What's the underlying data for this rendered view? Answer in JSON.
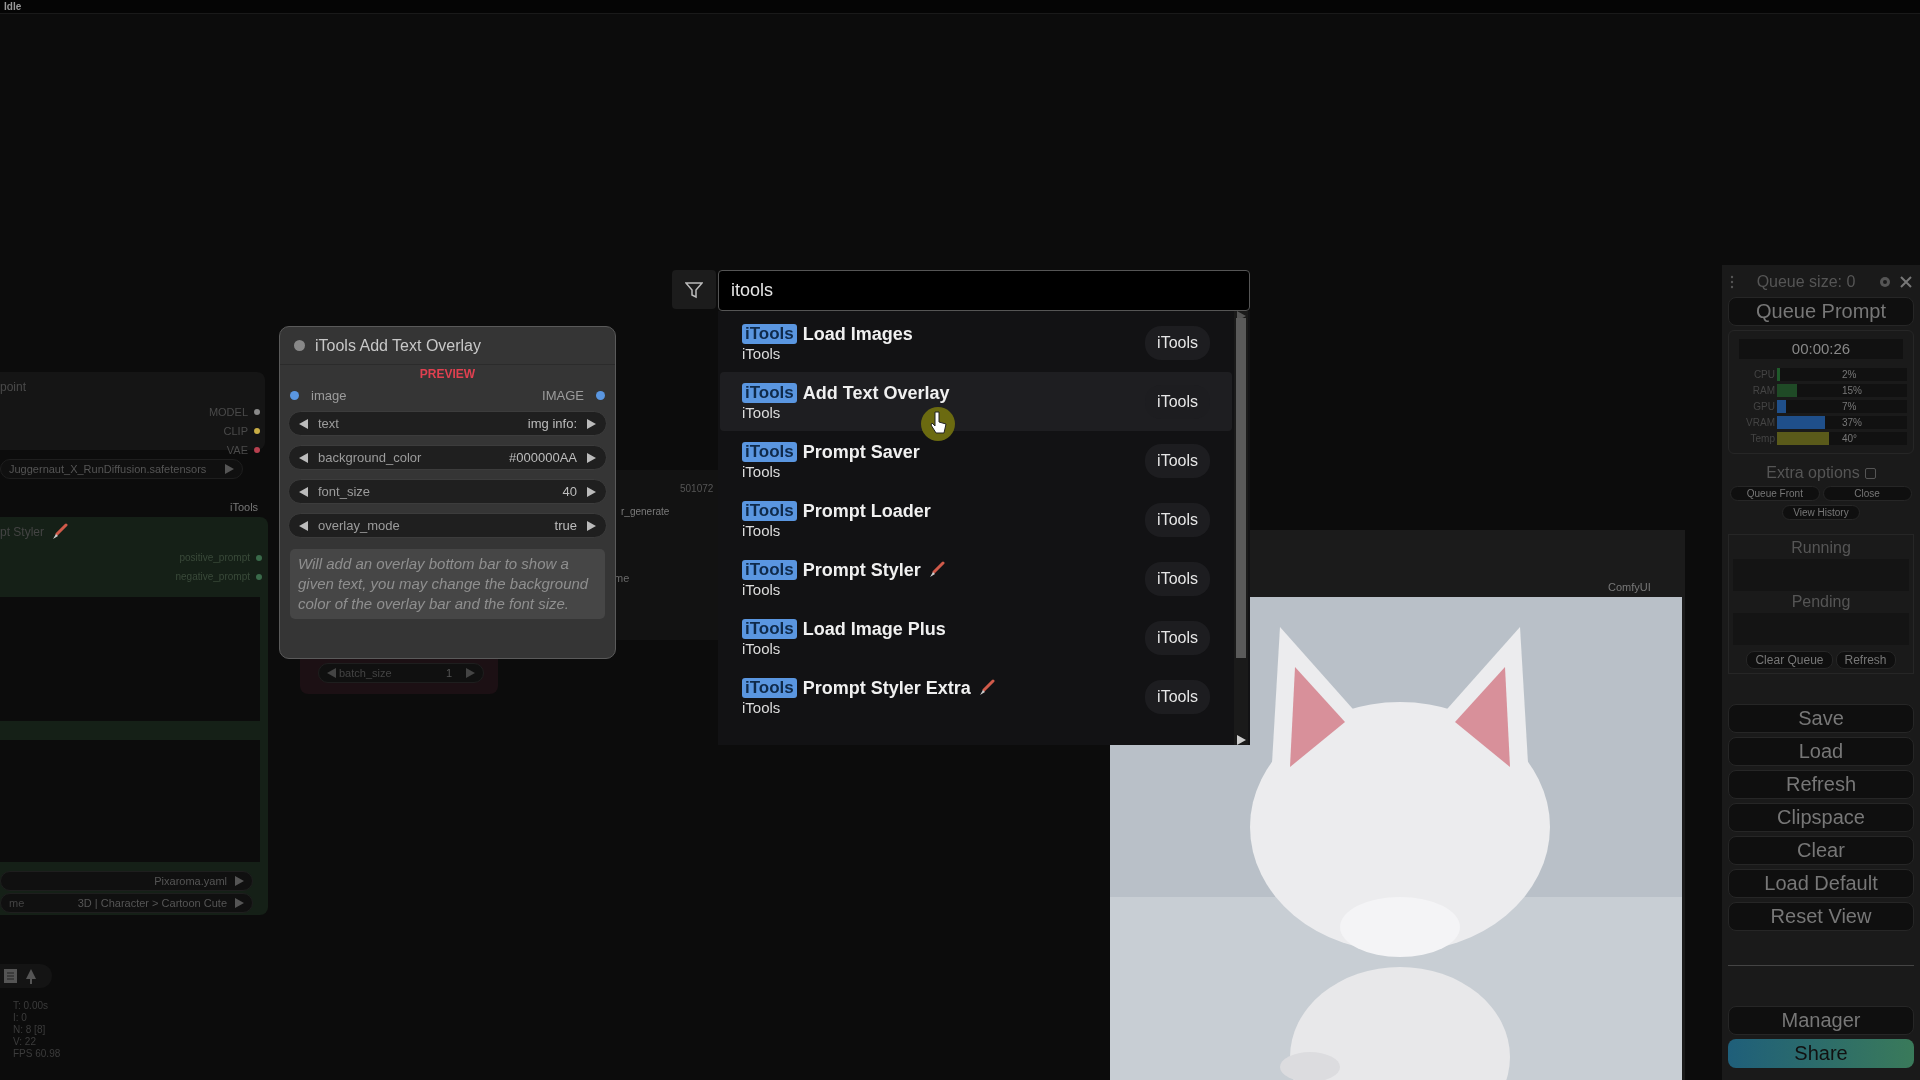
{
  "status": "Idle",
  "checkpoint_node": {
    "title": "point",
    "outputs": [
      {
        "label": "MODEL",
        "color": "#8a8a8a"
      },
      {
        "label": "CLIP",
        "color": "#c9ad45"
      },
      {
        "label": "VAE",
        "color": "#b8404f"
      }
    ],
    "combo": "Juggernaut_X_RunDiffusion.safetensors"
  },
  "group_label": "iTools",
  "styler_node": {
    "title": "pt Styler",
    "outputs": [
      "positive_prompt",
      "negative_prompt"
    ],
    "combos": [
      {
        "value": "Pixaroma.yaml"
      },
      {
        "label": "me",
        "value": "3D | Character > Cartoon Cute"
      }
    ]
  },
  "overlay_node": {
    "title": "iTools Add Text Overlay",
    "badge": "PREVIEW",
    "input": "image",
    "output": "IMAGE",
    "widgets": [
      {
        "name": "text",
        "value": "img info:"
      },
      {
        "name": "background_color",
        "value": "#000000AA"
      },
      {
        "name": "font_size",
        "value": "40"
      },
      {
        "name": "overlay_mode",
        "value": "true"
      }
    ],
    "description": "Will add an overlay bottom bar to show a given text, you may change the background color of the overlay bar and the font size."
  },
  "hidden_node_texts": [
    "501072",
    "r_generate",
    "me"
  ],
  "latent_node": {
    "name": "batch_size",
    "value": "1"
  },
  "search": {
    "value": "itools",
    "results": [
      {
        "tag": "iTools",
        "name": "Load Images",
        "category": "iTools",
        "source": "iTools",
        "selected": false,
        "brush": false
      },
      {
        "tag": "iTools",
        "name": "Add Text Overlay",
        "category": "iTools",
        "source": "iTools",
        "selected": true,
        "brush": false
      },
      {
        "tag": "iTools",
        "name": "Prompt Saver",
        "category": "iTools",
        "source": "iTools",
        "selected": false,
        "brush": false
      },
      {
        "tag": "iTools",
        "name": "Prompt Loader",
        "category": "iTools",
        "source": "iTools",
        "selected": false,
        "brush": false
      },
      {
        "tag": "iTools",
        "name": "Prompt Styler",
        "category": "iTools",
        "source": "iTools",
        "selected": false,
        "brush": true
      },
      {
        "tag": "iTools",
        "name": "Load Image Plus",
        "category": "iTools",
        "source": "iTools",
        "selected": false,
        "brush": false
      },
      {
        "tag": "iTools",
        "name": "Prompt Styler Extra",
        "category": "iTools",
        "source": "iTools",
        "selected": false,
        "brush": true
      }
    ]
  },
  "preview_node": {
    "badge": "ComfyUI"
  },
  "queue_panel": {
    "queue_size": "Queue size: 0",
    "queue_button": "Queue Prompt",
    "timer": "00:00:26",
    "monitors": [
      {
        "label": "CPU",
        "reading": "2%",
        "level": 0.02,
        "color": "#1f5a2a"
      },
      {
        "label": "RAM",
        "reading": "15%",
        "level": 0.15,
        "color": "#1f4a26"
      },
      {
        "label": "GPU",
        "reading": "7%",
        "level": 0.07,
        "color": "#1f4f8a"
      },
      {
        "label": "VRAM",
        "reading": "37%",
        "level": 0.37,
        "color": "#1f4f8a"
      },
      {
        "label": "Temp",
        "reading": "40°",
        "level": 0.4,
        "color": "#5a5a1a"
      }
    ],
    "extra_options": {
      "label": "Extra options",
      "checked": false
    },
    "option_buttons": [
      "Queue Front",
      "Close"
    ],
    "view_history": "View History",
    "running": "Running",
    "pending": "Pending",
    "queue_buttons": [
      "Clear Queue",
      "Refresh"
    ],
    "menu_buttons": [
      "Save",
      "Load",
      "Refresh",
      "Clipspace",
      "Clear",
      "Load Default",
      "Reset View"
    ],
    "bottom_buttons": [
      {
        "label": "Manager",
        "kind": "plain"
      },
      {
        "label": "Share",
        "kind": "gradient"
      }
    ]
  },
  "stats": [
    "T: 0.00s",
    "I: 0",
    "N: 8 [8]",
    "V: 22",
    "FPS 60.98"
  ]
}
